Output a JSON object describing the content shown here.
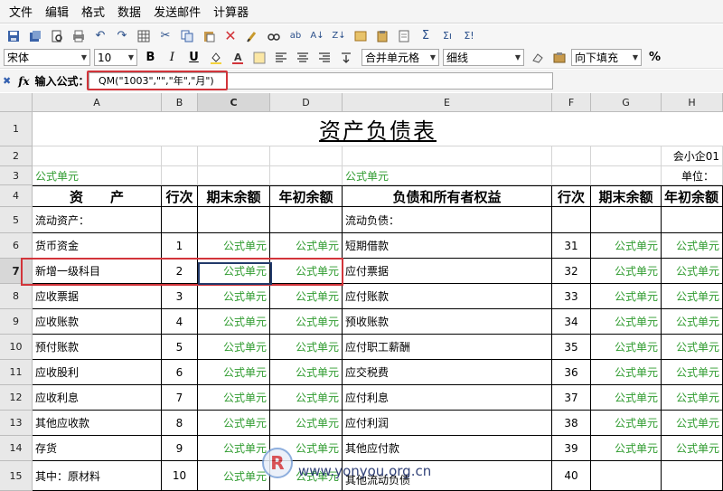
{
  "menu": [
    "文件",
    "编辑",
    "格式",
    "数据",
    "发送邮件",
    "计算器"
  ],
  "toolbar": {
    "font": "宋体",
    "font_size": "10",
    "merge": "合并单元格",
    "border": "细线",
    "fill": "向下填充",
    "bold": "B",
    "italic": "I",
    "underline": "U",
    "sum": "Σ",
    "percent": "%"
  },
  "formula_bar": {
    "label": "输入公式：",
    "fx": "fx",
    "value": "QM(\"1003\",\"\",\"年\",\"月\")"
  },
  "columns": [
    "A",
    "B",
    "C",
    "D",
    "E",
    "F",
    "G",
    "H"
  ],
  "rows": [
    "1",
    "2",
    "3",
    "4",
    "5",
    "6",
    "7",
    "8",
    "9",
    "10",
    "11",
    "12",
    "13",
    "14",
    "15"
  ],
  "sheet": {
    "title": "资产负债表",
    "company_code": "会小企01",
    "unit": "单位：",
    "formula_unit": "公式单元",
    "headers": {
      "asset": "资　　产",
      "row_no": "行次",
      "end_balance": "期末余额",
      "start_balance": "年初余额",
      "liability": "负债和所有者权益",
      "row_no2": "行次",
      "end_balance2": "期末余额",
      "start_balance2": "年初余额"
    },
    "left_section": "流动资产：",
    "right_section": "流动负债：",
    "lines": [
      {
        "asset": "货币资金",
        "no": "1",
        "liab": "短期借款",
        "no2": "31"
      },
      {
        "asset": "新增一级科目",
        "no": "2",
        "liab": "应付票据",
        "no2": "32"
      },
      {
        "asset": "应收票据",
        "no": "3",
        "liab": "应付账款",
        "no2": "33"
      },
      {
        "asset": "应收账款",
        "no": "4",
        "liab": "预收账款",
        "no2": "34"
      },
      {
        "asset": "预付账款",
        "no": "5",
        "liab": "应付职工薪酬",
        "no2": "35"
      },
      {
        "asset": "应收股利",
        "no": "6",
        "liab": "应交税费",
        "no2": "36"
      },
      {
        "asset": "应收利息",
        "no": "7",
        "liab": "应付利息",
        "no2": "37"
      },
      {
        "asset": "其他应收款",
        "no": "8",
        "liab": "应付利润",
        "no2": "38"
      },
      {
        "asset": "存货",
        "no": "9",
        "liab": "其他应付款",
        "no2": "39"
      },
      {
        "asset": "其中：原材料",
        "no": "10",
        "liab": "其他流动负债",
        "no2": "40"
      }
    ]
  },
  "watermark": "www.yonyou.org.cn"
}
